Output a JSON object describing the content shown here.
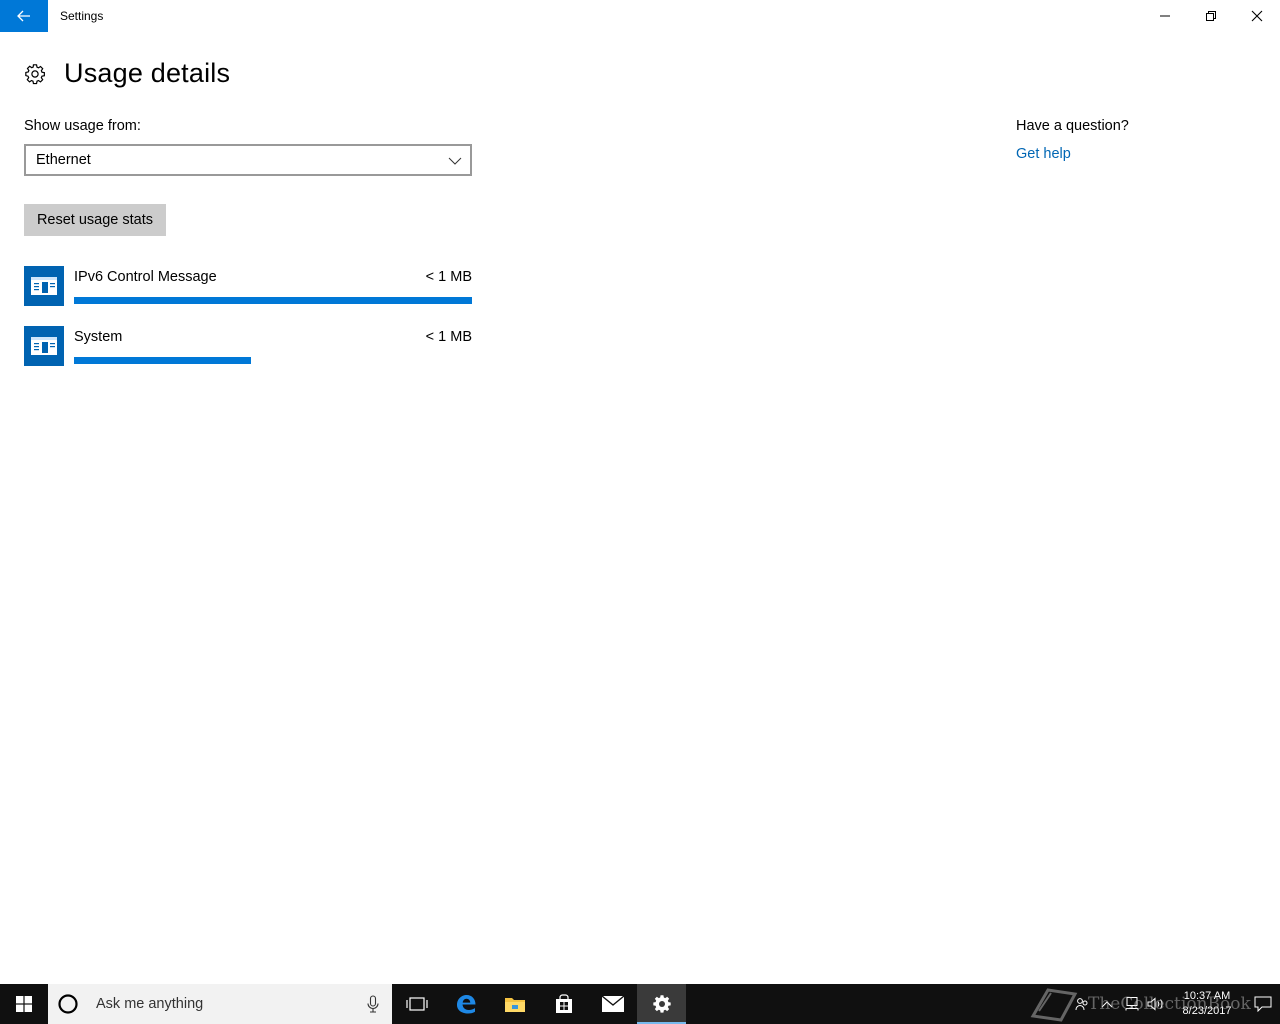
{
  "window": {
    "title": "Settings"
  },
  "header": {
    "title": "Usage details",
    "icon": "gear-icon"
  },
  "usage": {
    "show_label": "Show usage from:",
    "selected_source": "Ethernet",
    "reset_label": "Reset usage stats",
    "apps": [
      {
        "name": "IPv6 Control Message",
        "size": "< 1 MB",
        "share": 1.0
      },
      {
        "name": "System",
        "size": "< 1 MB",
        "share": 0.445
      }
    ]
  },
  "help": {
    "question": "Have a question?",
    "link": "Get help"
  },
  "taskbar": {
    "search_placeholder": "Ask me anything",
    "clock_time": "10:37 AM",
    "clock_date": "8/23/2017",
    "watermark": "TheCollectionBook"
  },
  "colors": {
    "accent": "#0078d7",
    "app_tile": "#0063b1",
    "link": "#0066b4",
    "button": "#cccccc",
    "taskbar": "#101010"
  }
}
